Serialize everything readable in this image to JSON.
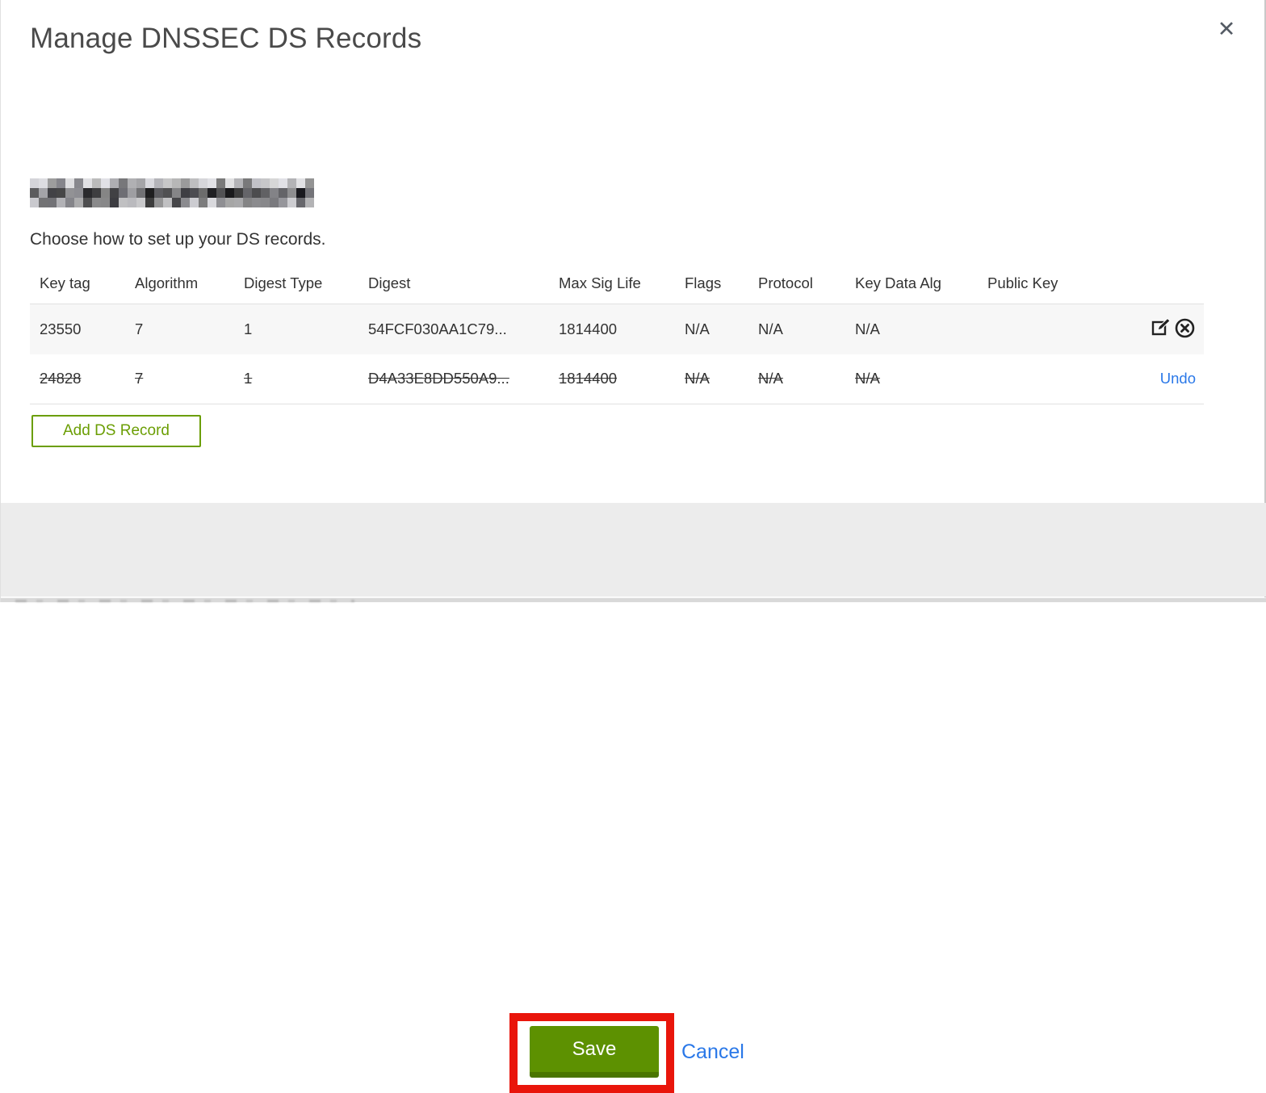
{
  "modal": {
    "title": "Manage DNSSEC DS Records",
    "close_label": "✕",
    "intro": "Choose how to set up your DS records."
  },
  "table": {
    "headers": [
      "Key tag",
      "Algorithm",
      "Digest Type",
      "Digest",
      "Max Sig Life",
      "Flags",
      "Protocol",
      "Key Data Alg",
      "Public Key"
    ],
    "rows": [
      {
        "key_tag": "23550",
        "algorithm": "7",
        "digest_type": "1",
        "digest": "54FCF030AA1C79...",
        "max_sig_life": "1814400",
        "flags": "N/A",
        "protocol": "N/A",
        "key_data_alg": "N/A",
        "public_key": "",
        "state": "current"
      },
      {
        "key_tag": "24828",
        "algorithm": "7",
        "digest_type": "1",
        "digest": "D4A33E8DD550A9...",
        "max_sig_life": "1814400",
        "flags": "N/A",
        "protocol": "N/A",
        "key_data_alg": "N/A",
        "public_key": "",
        "state": "deleted",
        "undo_label": "Undo"
      }
    ]
  },
  "buttons": {
    "add_ds_record": "Add DS Record",
    "save": "Save",
    "cancel": "Cancel"
  },
  "colors": {
    "save_green": "#5d9101",
    "save_green_dark": "#4a7500",
    "outline_green": "#6b9e04",
    "link_blue": "#2a78e8",
    "annotation_red": "#e9150b",
    "row_alt_bg": "#f7f7f7",
    "footer_bg": "#ececec"
  }
}
